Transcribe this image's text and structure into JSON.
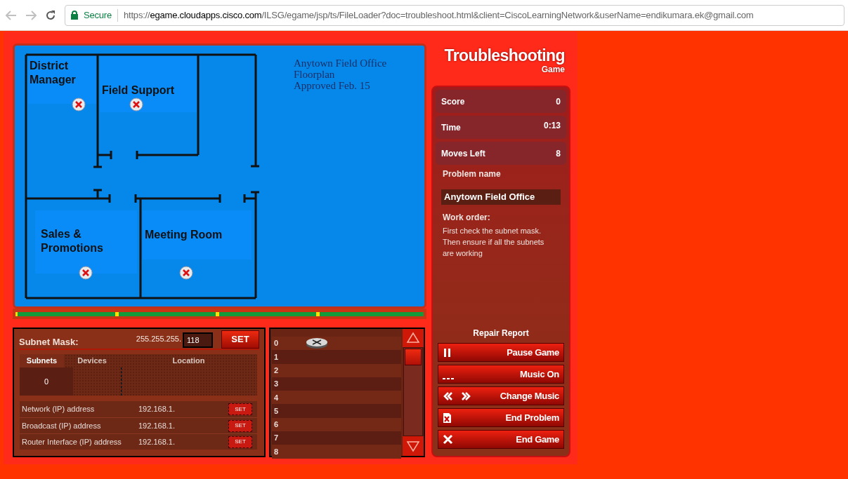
{
  "browser": {
    "secure_label": "Secure",
    "url_scheme": "https://",
    "url_host": "egame.cloudapps.cisco.com",
    "url_path": "/ILSG/egame/jsp/ts/FileLoader?doc=troubleshoot.html&client=CiscoLearningNetwork&userName=endikumara.ek@gmail.com"
  },
  "floorplan": {
    "note": [
      "Anytown Field Office",
      "Floorplan",
      "Approved Feb. 15"
    ],
    "rooms": [
      {
        "lines": [
          "District",
          "Manager"
        ],
        "failed": true
      },
      {
        "lines": [
          "Field Support"
        ],
        "failed": true
      },
      {
        "lines": [
          "Sales &",
          "Promotions"
        ],
        "failed": true
      },
      {
        "lines": [
          "Meeting Room"
        ],
        "failed": true
      }
    ]
  },
  "subnet_panel": {
    "label": "Subnet Mask:",
    "prefix": "255.255.255.",
    "value": "118",
    "set_label": "SET",
    "columns": [
      {
        "label": "Subnets",
        "selected": true
      },
      {
        "label": "Devices",
        "selected": false
      },
      {
        "label": "Location",
        "selected": false
      }
    ],
    "row": {
      "subnet": "0"
    },
    "addresses": [
      {
        "label": "Network (IP) address",
        "value": "192.168.1.",
        "button": "SET"
      },
      {
        "label": "Broadcast (IP) address",
        "value": "192.168.1.",
        "button": "SET"
      },
      {
        "label": "Router Interface (IP) address",
        "value": "192.168.1.",
        "button": "SET"
      }
    ]
  },
  "device_list": {
    "rows": [
      {
        "index": "0",
        "device": true
      },
      {
        "index": "1",
        "device": false
      },
      {
        "index": "2",
        "device": false
      },
      {
        "index": "3",
        "device": false
      },
      {
        "index": "4",
        "device": false
      },
      {
        "index": "5",
        "device": false
      },
      {
        "index": "6",
        "device": false
      },
      {
        "index": "7",
        "device": false
      },
      {
        "index": "8",
        "device": false
      }
    ]
  },
  "sidebar": {
    "logo": "Troubleshooting",
    "logo_sub": "Game",
    "stats": [
      {
        "label": "Score",
        "value": "0"
      },
      {
        "label": "Time",
        "value": "0:13"
      },
      {
        "label": "Moves Left",
        "value": "8"
      }
    ],
    "problem_label": "Problem name",
    "problem_name": "Anytown Field Office",
    "work_order_label": "Work order:",
    "work_order": "First check the subnet mask.  Then ensure if all the subnets are working",
    "report_label": "Repair Report",
    "buttons": [
      {
        "kind": "pause",
        "label": "Pause Game"
      },
      {
        "kind": "music",
        "label": "Music On"
      },
      {
        "kind": "change",
        "label": "Change Music"
      },
      {
        "kind": "end-problem",
        "label": "End Problem"
      },
      {
        "kind": "end-game",
        "label": "End Game"
      }
    ]
  }
}
